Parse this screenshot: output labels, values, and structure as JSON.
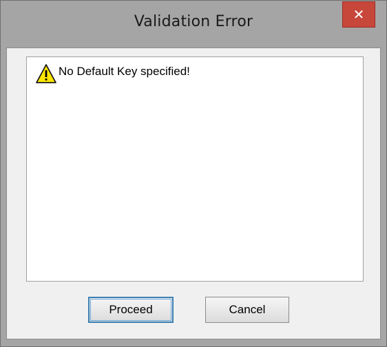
{
  "window": {
    "title": "Validation Error",
    "close_icon": "close-icon"
  },
  "message": {
    "icon": "warning-icon",
    "text": "No Default Key specified!"
  },
  "buttons": {
    "proceed_label": "Proceed",
    "cancel_label": "Cancel"
  },
  "colors": {
    "close_button": "#c7473b",
    "focus_border": "#3c7fb1",
    "warning_fill": "#ffe600"
  }
}
